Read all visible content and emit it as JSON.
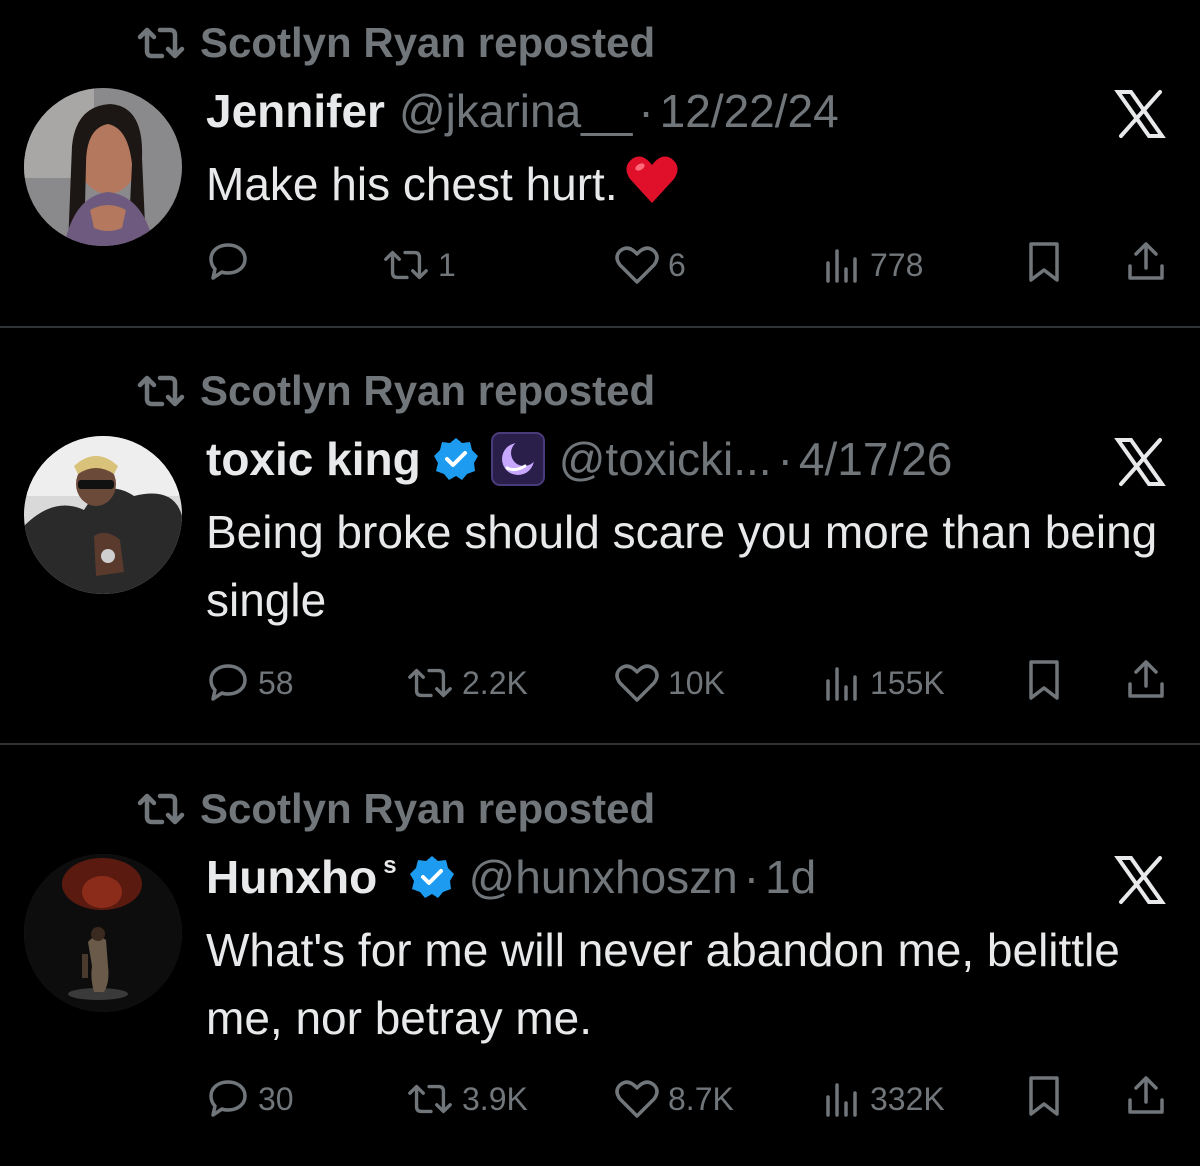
{
  "theme": {
    "background": "#000000",
    "text": "#e7e9ea",
    "muted": "#71767b",
    "divider": "#2f3336",
    "verified_blue": "#1d9bf0",
    "heart_red": "#e0102a"
  },
  "tweets": [
    {
      "repost_label": "Scotlyn Ryan reposted",
      "name": "Jennifer",
      "name_suffix": "",
      "verified": false,
      "handle": "@jkarina__",
      "separator": "·",
      "date": "12/22/24",
      "text": "Make his chest hurt.",
      "emoji": "red-heart",
      "stats": {
        "replies": "",
        "reposts": "1",
        "likes": "6",
        "views": "778"
      }
    },
    {
      "repost_label": "Scotlyn Ryan reposted",
      "name": "toxic king",
      "name_suffix": "",
      "verified": true,
      "handle": "@toxicki...",
      "separator": "·",
      "date": "4/17/26",
      "text": "Being broke should scare you more than being single",
      "emoji": "",
      "stats": {
        "replies": "58",
        "reposts": "2.2K",
        "likes": "10K",
        "views": "155K"
      }
    },
    {
      "repost_label": "Scotlyn Ryan reposted",
      "name": "Hunxho",
      "name_suffix": "s",
      "verified": true,
      "handle": "@hunxhoszn",
      "separator": "·",
      "date": "1d",
      "text": "What's for me will never abandon me, belittle me, nor betray me.",
      "emoji": "",
      "stats": {
        "replies": "30",
        "reposts": "3.9K",
        "likes": "8.7K",
        "views": "332K"
      }
    }
  ],
  "icons": {
    "repost": "repost-icon",
    "reply": "reply-icon",
    "like": "heart-icon",
    "views": "views-icon",
    "bookmark": "bookmark-icon",
    "share": "share-icon",
    "dismiss": "x-close-icon",
    "verified": "verified-badge-icon",
    "affiliate": "moon-affiliate-icon"
  }
}
